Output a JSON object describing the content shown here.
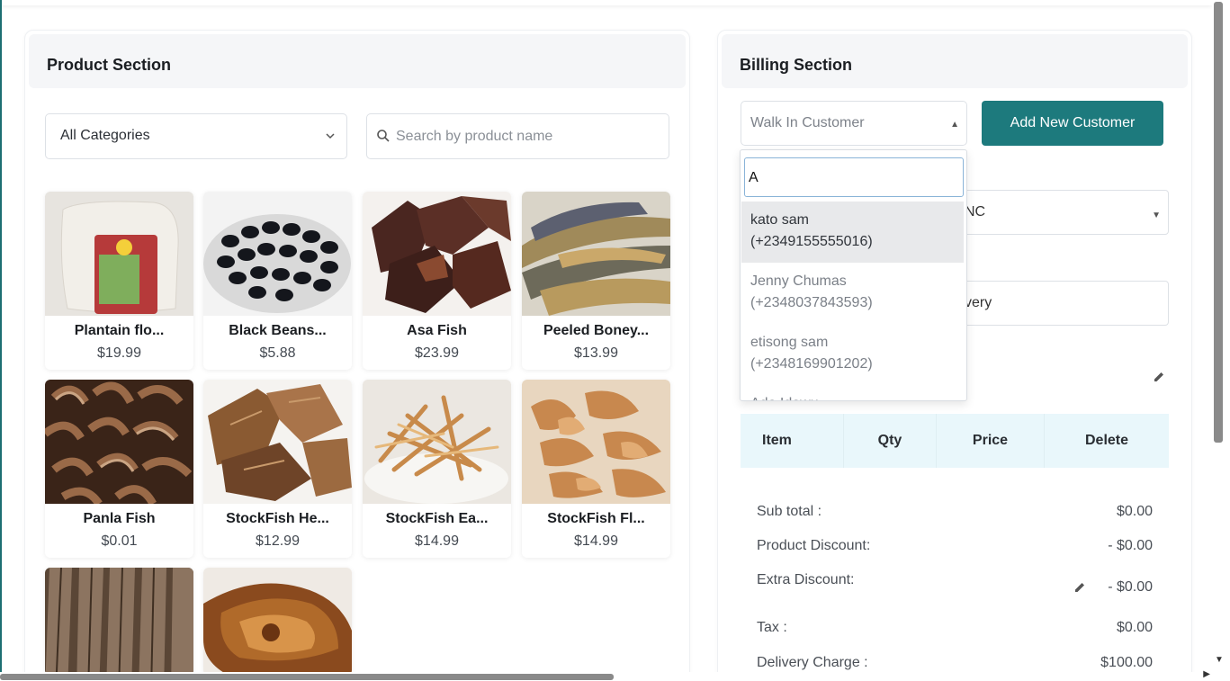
{
  "product_section": {
    "title": "Product Section",
    "category_select": "All Categories",
    "search_placeholder": "Search by product name",
    "products": [
      {
        "name": "Plantain flo...",
        "price": "$19.99"
      },
      {
        "name": "Black Beans...",
        "price": "$5.88"
      },
      {
        "name": "Asa Fish",
        "price": "$23.99"
      },
      {
        "name": "Peeled Boney...",
        "price": "$13.99"
      },
      {
        "name": "Panla Fish",
        "price": "$0.01"
      },
      {
        "name": "StockFish He...",
        "price": "$12.99"
      },
      {
        "name": "StockFish Ea...",
        "price": "$14.99"
      },
      {
        "name": "StockFish Fl...",
        "price": "$14.99"
      }
    ]
  },
  "billing_section": {
    "title": "Billing Section",
    "customer_select": "Walk In Customer",
    "add_customer_label": "Add New Customer",
    "hidden_select_fragment": "NC",
    "hidden_input_fragment": "very",
    "table_headers": {
      "item": "Item",
      "qty": "Qty",
      "price": "Price",
      "delete": "Delete"
    },
    "summary": {
      "subtotal_label": "Sub total :",
      "subtotal_value": "$0.00",
      "product_discount_label": "Product Discount:",
      "product_discount_value": "- $0.00",
      "extra_discount_label": "Extra Discount:",
      "extra_discount_value": "- $0.00",
      "tax_label": "Tax :",
      "tax_value": "$0.00",
      "delivery_label": "Delivery Charge :",
      "delivery_value": "$100.00"
    }
  },
  "customer_dropdown": {
    "search_value": "A",
    "options": [
      {
        "name": "kato sam",
        "phone": "(+2349155555016)"
      },
      {
        "name": "Jenny Chumas",
        "phone": "(+2348037843593)"
      },
      {
        "name": "etisong sam",
        "phone": "(+2348169901202)"
      },
      {
        "name": "Ade Idowu",
        "phone": ""
      }
    ]
  },
  "colors": {
    "accent": "#1d7a7d",
    "table_header": "#e9f7fb",
    "panel_header": "#f5f6f8"
  }
}
